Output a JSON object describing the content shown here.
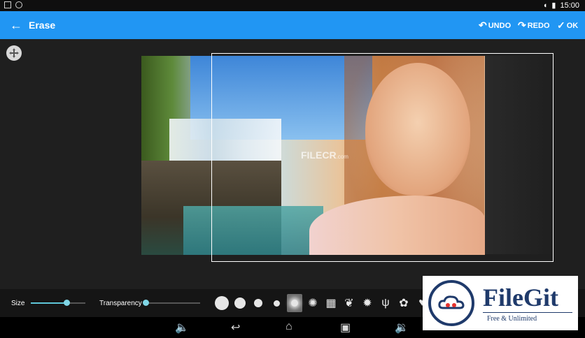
{
  "status_bar": {
    "time": "15:00"
  },
  "app_bar": {
    "title": "Erase",
    "undo_label": "UNDO",
    "redo_label": "REDO",
    "ok_label": "OK"
  },
  "canvas": {
    "watermark": "FILECR",
    "watermark_sub": ".com"
  },
  "toolbar": {
    "size_label": "Size",
    "size_value": 0.65,
    "transparency_label": "Transparency",
    "transparency_value": 0.0,
    "accent_color": "#5fc6d8",
    "brushes": [
      "circle-large",
      "circle-medium",
      "circle-soft",
      "circle-small",
      "circle-glow",
      "splatter",
      "texture",
      "leaf-stroke",
      "bug",
      "grass",
      "maple-leaf",
      "heart",
      "heart-outline"
    ]
  },
  "filegit": {
    "name": "FileGit",
    "tagline": "Free & Unlimited"
  },
  "colors": {
    "app_bar": "#2196f3",
    "background": "#1e1e1e"
  }
}
